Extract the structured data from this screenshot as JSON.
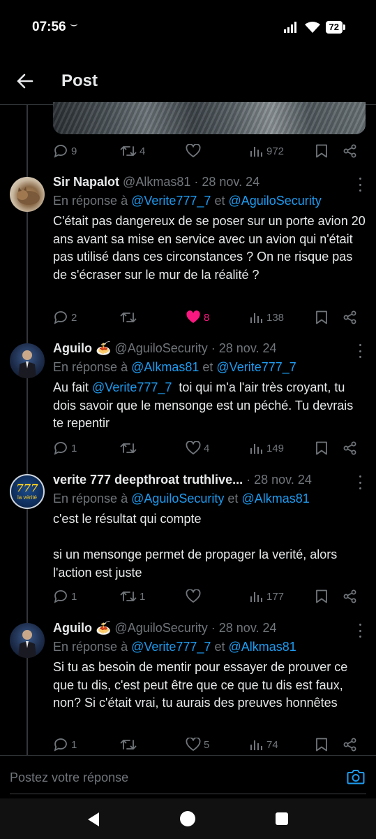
{
  "status": {
    "time": "07:56",
    "sync": "⌣",
    "battery": "72"
  },
  "header": {
    "title": "Post"
  },
  "prev_actions": {
    "replies": "9",
    "reposts": "4",
    "likes": "",
    "views": "972"
  },
  "tweets": [
    {
      "name": "Sir Napalot",
      "handle": "@Alkmas81",
      "date": "· 28 nov. 24",
      "reply_prefix": "En réponse à ",
      "reply_mention1": "@Verite777_7",
      "reply_sep": " et ",
      "reply_mention2": "@AguiloSecurity",
      "text": "C'était pas dangereux de se poser sur un porte avion 20 ans avant sa mise en service avec un avion qui n'était pas utilisé dans ces circonstances ? On ne risque pas de s'écraser sur le mur de la réalité ?",
      "replies": "2",
      "reposts": "",
      "likes": "8",
      "views": "138"
    },
    {
      "name": "Aguilo 🍝",
      "handle": "@AguiloSecurity",
      "date": "· 28 nov. 24",
      "reply_prefix": "En réponse à ",
      "reply_mention1": "@Alkmas81",
      "reply_sep": " et ",
      "reply_mention2": "@Verite777_7",
      "text_before": "Au fait ",
      "text_mention": "@Verite777_7",
      "text_after": "  toi qui m'a l'air très croyant, tu dois savoir que le mensonge est un péché. Tu devrais te repentir",
      "replies": "1",
      "reposts": "",
      "likes": "4",
      "views": "149"
    },
    {
      "name": "verite 777 deepthroat truthlive...",
      "handle": "",
      "date": "· 28 nov. 24",
      "avatar_text": "777",
      "avatar_sub": "la vérité",
      "reply_prefix": "En réponse à ",
      "reply_mention1": "@AguiloSecurity",
      "reply_sep": " et ",
      "reply_mention2": "@Alkmas81",
      "text_p1": "c'est le résultat qui compte",
      "text_p2": "si un mensonge permet de propager la verité, alors l'action est juste",
      "replies": "1",
      "reposts": "1",
      "likes": "",
      "views": "177"
    },
    {
      "name": "Aguilo 🍝",
      "handle": "@AguiloSecurity",
      "date": "· 28 nov. 24",
      "reply_prefix": "En réponse à ",
      "reply_mention1": "@Verite777_7",
      "reply_sep": " et ",
      "reply_mention2": "@Alkmas81",
      "text": "Si tu as besoin de mentir pour essayer de prouver ce que tu dis, c'est peut être que ce que tu dis est faux, non? Si c'était vrai, tu aurais des preuves honnêtes",
      "replies": "1",
      "reposts": "",
      "likes": "5",
      "views": "74"
    }
  ],
  "compose": {
    "placeholder": "Postez votre réponse"
  },
  "colors": {
    "background": "#000000",
    "accent": "#1d9bf0",
    "like": "#f91880",
    "muted": "#71767b"
  }
}
